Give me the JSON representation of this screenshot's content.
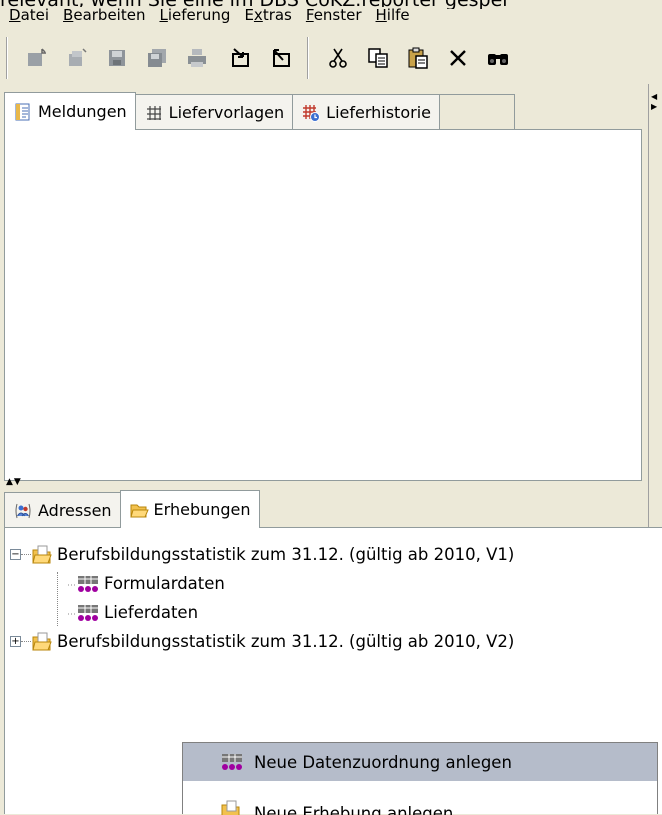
{
  "overflow_text": "relevant, wenn Sie eine im DBS CoKZ.reporter gespei",
  "menu": [
    {
      "label_pre": "",
      "accel": "D",
      "label_post": "atei"
    },
    {
      "label_pre": "",
      "accel": "B",
      "label_post": "earbeiten"
    },
    {
      "label_pre": "",
      "accel": "L",
      "label_post": "ieferung"
    },
    {
      "label_pre": "E",
      "accel": "x",
      "label_post": "tras"
    },
    {
      "label_pre": "",
      "accel": "F",
      "label_post": "enster"
    },
    {
      "label_pre": "",
      "accel": "H",
      "label_post": "ilfe"
    }
  ],
  "toolbar": {
    "icons": [
      "new-doc-icon",
      "new-doc-disabled-icon",
      "save-icon",
      "save-all-icon",
      "print-icon",
      "import-icon",
      "export-icon",
      "cut-icon",
      "copy-icon",
      "paste-icon",
      "delete-icon",
      "find-icon"
    ]
  },
  "top_tabs": [
    {
      "label": "Meldungen",
      "icon": "messages-icon",
      "active": true
    },
    {
      "label": "Liefervorlagen",
      "icon": "template-grid-icon",
      "active": false
    },
    {
      "label": "Lieferhistorie",
      "icon": "history-grid-icon",
      "active": false
    }
  ],
  "bottom_tabs": [
    {
      "label": "Adressen",
      "icon": "addresses-icon",
      "active": false
    },
    {
      "label": "Erhebungen",
      "icon": "folder-open-icon",
      "active": true
    }
  ],
  "tree": {
    "root1": {
      "label": "Berufsbildungsstatistik zum 31.12. (gültig ab 2010, V1)",
      "expanded": true
    },
    "child1": {
      "label": "Formulardaten"
    },
    "child2": {
      "label": "Lieferdaten"
    },
    "root2": {
      "label": "Berufsbildungsstatistik zum 31.12. (gültig ab 2010, V2)",
      "expanded": false
    }
  },
  "context_menu": {
    "item1": {
      "label": "Neue Datenzuordnung anlegen",
      "highlighted": true
    },
    "item2": {
      "label": "Neue Erhebung anlegen",
      "highlighted": false
    }
  },
  "colors": {
    "bg": "#ece9d8",
    "selection": "#b5bcca",
    "data_icon": "#a000a0"
  }
}
